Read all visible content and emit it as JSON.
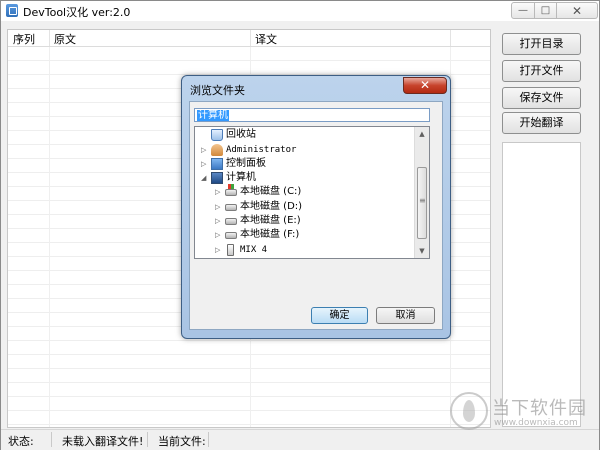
{
  "window": {
    "title": "DevTool汉化 ver:2.0",
    "controls": {
      "min": "—",
      "max": "□",
      "close": "✕"
    }
  },
  "list": {
    "columns": [
      "序列",
      "原文",
      "译文"
    ]
  },
  "side_buttons": {
    "open_dir": "打开目录",
    "open_file": "打开文件",
    "save_file": "保存文件",
    "start_translate": "开始翻译"
  },
  "status_bar": {
    "status_label": "状态:",
    "status_value": "未载入翻译文件!",
    "current_file_label": "当前文件:"
  },
  "dialog": {
    "title": "浏览文件夹",
    "close": "✕",
    "folder_value": "计算机",
    "tree": [
      {
        "label": "回收站",
        "icon": "recycle-bin-icon",
        "expander": ""
      },
      {
        "label": "Administrator",
        "icon": "user-folder-icon",
        "expander": "▷"
      },
      {
        "label": "控制面板",
        "icon": "control-panel-icon",
        "expander": "▷"
      },
      {
        "label": "计算机",
        "icon": "computer-icon",
        "expander": "◢"
      },
      {
        "label": "本地磁盘 (C:)",
        "icon": "system-drive-icon",
        "expander": "▷"
      },
      {
        "label": "本地磁盘 (D:)",
        "icon": "drive-icon",
        "expander": "▷"
      },
      {
        "label": "本地磁盘 (E:)",
        "icon": "drive-icon",
        "expander": "▷"
      },
      {
        "label": "本地磁盘 (F:)",
        "icon": "drive-icon",
        "expander": "▷"
      },
      {
        "label": "MIX 4",
        "icon": "phone-icon",
        "expander": "▷"
      }
    ],
    "ok": "确定",
    "cancel": "取消"
  },
  "watermark": {
    "name": "当下软件园",
    "url": "www.downxia.com"
  }
}
